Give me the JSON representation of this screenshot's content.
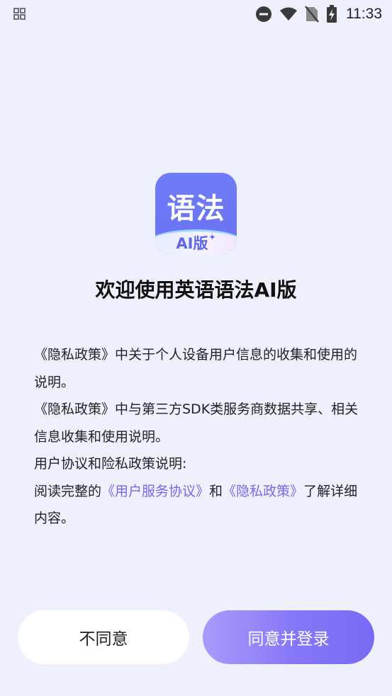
{
  "status_bar": {
    "time": "11:33",
    "icons": [
      "grid-notification-icon",
      "do-not-disturb-icon",
      "wifi-icon",
      "no-sim-icon",
      "battery-charging-icon"
    ]
  },
  "app_logo": {
    "text": "语法",
    "badge": "AI版",
    "sparkle": "✦"
  },
  "title": "欢迎使用英语语法AI版",
  "policy": {
    "line1": "《隐私政策》中关于个人设备用户信息的收集和使用的说明。",
    "line2": "《隐私政策》中与第三方SDK类服务商数据共享、相关信息收集和使用说明。",
    "line3": "用户协议和险私政策说明:",
    "line4_prefix": "阅读完整的",
    "user_agreement_link": "《用户服务协议》",
    "and": "和",
    "privacy_link": "《隐私政策》",
    "line4_suffix": "了解详细内容。"
  },
  "buttons": {
    "disagree": "不同意",
    "agree": "同意并登录"
  },
  "colors": {
    "background": "#eef1fd",
    "link": "#7667ee",
    "primary": "#8477f7"
  }
}
